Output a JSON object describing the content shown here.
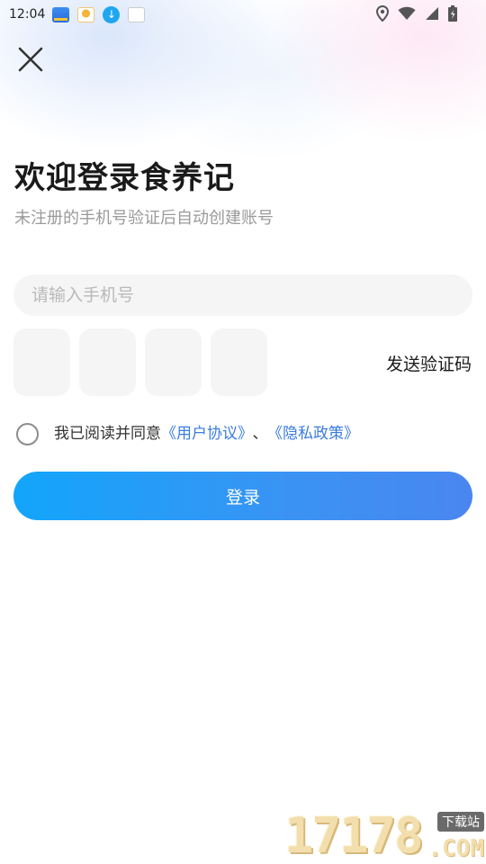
{
  "status_bar": {
    "time": "12:04",
    "notification_icons": [
      "app-notification-icon",
      "app-notification-icon",
      "download-icon",
      "app-notification-icon"
    ],
    "right_icons": [
      "location-icon",
      "wifi-icon",
      "signal-icon",
      "battery-icon"
    ]
  },
  "page": {
    "title": "欢迎登录食养记",
    "subtitle": "未注册的手机号验证后自动创建账号"
  },
  "form": {
    "phone_placeholder": "请输入手机号",
    "phone_value": "",
    "code_length": 4,
    "send_code_label": "发送验证码"
  },
  "agreement": {
    "checked": false,
    "prefix": "我已阅读并同意",
    "user_agreement": "《用户协议》",
    "separator": "、",
    "privacy_policy": "《隐私政策》"
  },
  "actions": {
    "login_label": "登录"
  },
  "watermark": {
    "number": "17178",
    "tag": "下载站",
    "suffix": ".COM"
  },
  "colors": {
    "accent": "#3a7be0",
    "button_start": "#12a5fb",
    "button_end": "#4a86f0",
    "field_bg": "#f5f5f5"
  }
}
